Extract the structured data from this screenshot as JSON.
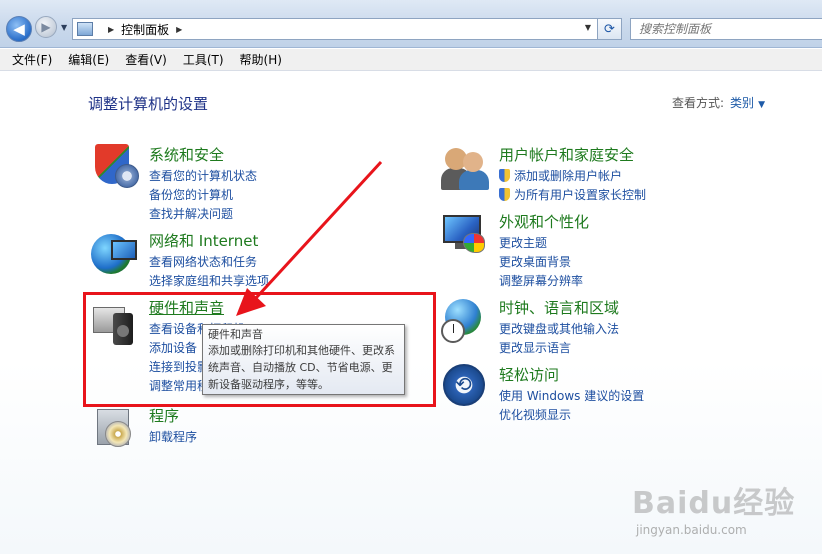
{
  "address_bar": {
    "breadcrumb": "控制面板",
    "search_placeholder": "搜索控制面板"
  },
  "menu": [
    "文件(F)",
    "编辑(E)",
    "查看(V)",
    "工具(T)",
    "帮助(H)"
  ],
  "page": {
    "title": "调整计算机的设置",
    "view_by_label": "查看方式:",
    "view_by_value": "类别"
  },
  "categories": {
    "system": {
      "title": "系统和安全",
      "links": [
        "查看您的计算机状态",
        "备份您的计算机",
        "查找并解决问题"
      ]
    },
    "network": {
      "title": "网络和 Internet",
      "links": [
        "查看网络状态和任务",
        "选择家庭组和共享选项"
      ]
    },
    "hardware": {
      "title": "硬件和声音",
      "links": [
        "查看设备和打印机",
        "添加设备",
        "连接到投影仪",
        "调整常用移动设置"
      ]
    },
    "programs": {
      "title": "程序",
      "links": [
        "卸载程序"
      ]
    },
    "users": {
      "title": "用户帐户和家庭安全",
      "links": [
        "添加或删除用户帐户",
        "为所有用户设置家长控制"
      ]
    },
    "appearance": {
      "title": "外观和个性化",
      "links": [
        "更改主题",
        "更改桌面背景",
        "调整屏幕分辨率"
      ]
    },
    "clock": {
      "title": "时钟、语言和区域",
      "links": [
        "更改键盘或其他输入法",
        "更改显示语言"
      ]
    },
    "access": {
      "title": "轻松访问",
      "links": [
        "使用 Windows 建议的设置",
        "优化视频显示"
      ]
    }
  },
  "tooltip": {
    "title": "硬件和声音",
    "body": "添加或删除打印机和其他硬件、更改系统声音、自动播放 CD、节省电源、更新设备驱动程序，等等。"
  },
  "watermark": {
    "logo": "Baidu经验",
    "url": "jingyan.baidu.com"
  },
  "colors": {
    "annotation": "#e8141b",
    "category_title": "#1e7a1e",
    "link": "#1e4fa0",
    "page_title": "#1e3287"
  }
}
